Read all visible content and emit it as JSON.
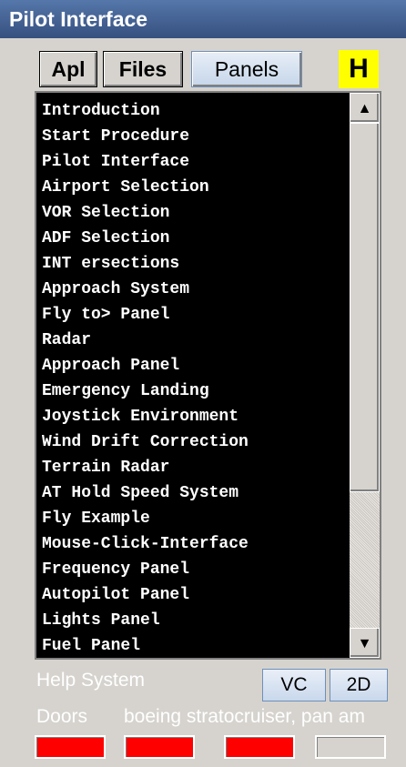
{
  "window": {
    "title": "Pilot Interface"
  },
  "tabs": {
    "apl": "Apl",
    "files": "Files",
    "panels": "Panels",
    "help": "H"
  },
  "list": {
    "items": [
      "Introduction",
      "Start Procedure",
      "Pilot Interface",
      "Airport Selection",
      "VOR Selection",
      "ADF Selection",
      "INT ersections",
      "Approach System",
      "Fly to> Panel",
      "Radar",
      "Approach Panel",
      "Emergency Landing",
      "Joystick Environment",
      "Wind Drift Correction",
      "Terrain Radar",
      "AT Hold Speed System",
      "Fly Example",
      "Mouse-Click-Interface",
      "Frequency Panel",
      "Autopilot Panel",
      "Lights Panel",
      "Fuel Panel"
    ],
    "scroll_up_icon": "arrow-up-icon",
    "scroll_down_icon": "arrow-down-icon"
  },
  "footer": {
    "help_system": "Help System",
    "vc": "VC",
    "two_d": "2D",
    "doors": "Doors",
    "aircraft": "boeing stratocruiser, pan am"
  },
  "indicators": [
    {
      "state": "red",
      "color": "#ff0000"
    },
    {
      "state": "red",
      "color": "#ff0000"
    },
    {
      "state": "red",
      "color": "#ff0000"
    },
    {
      "state": "off",
      "color": "#d6d3ce"
    }
  ],
  "colors": {
    "title_bar": "#36507f",
    "help_button": "#ffff00",
    "list_bg": "#000000",
    "list_text": "#ffffff"
  }
}
